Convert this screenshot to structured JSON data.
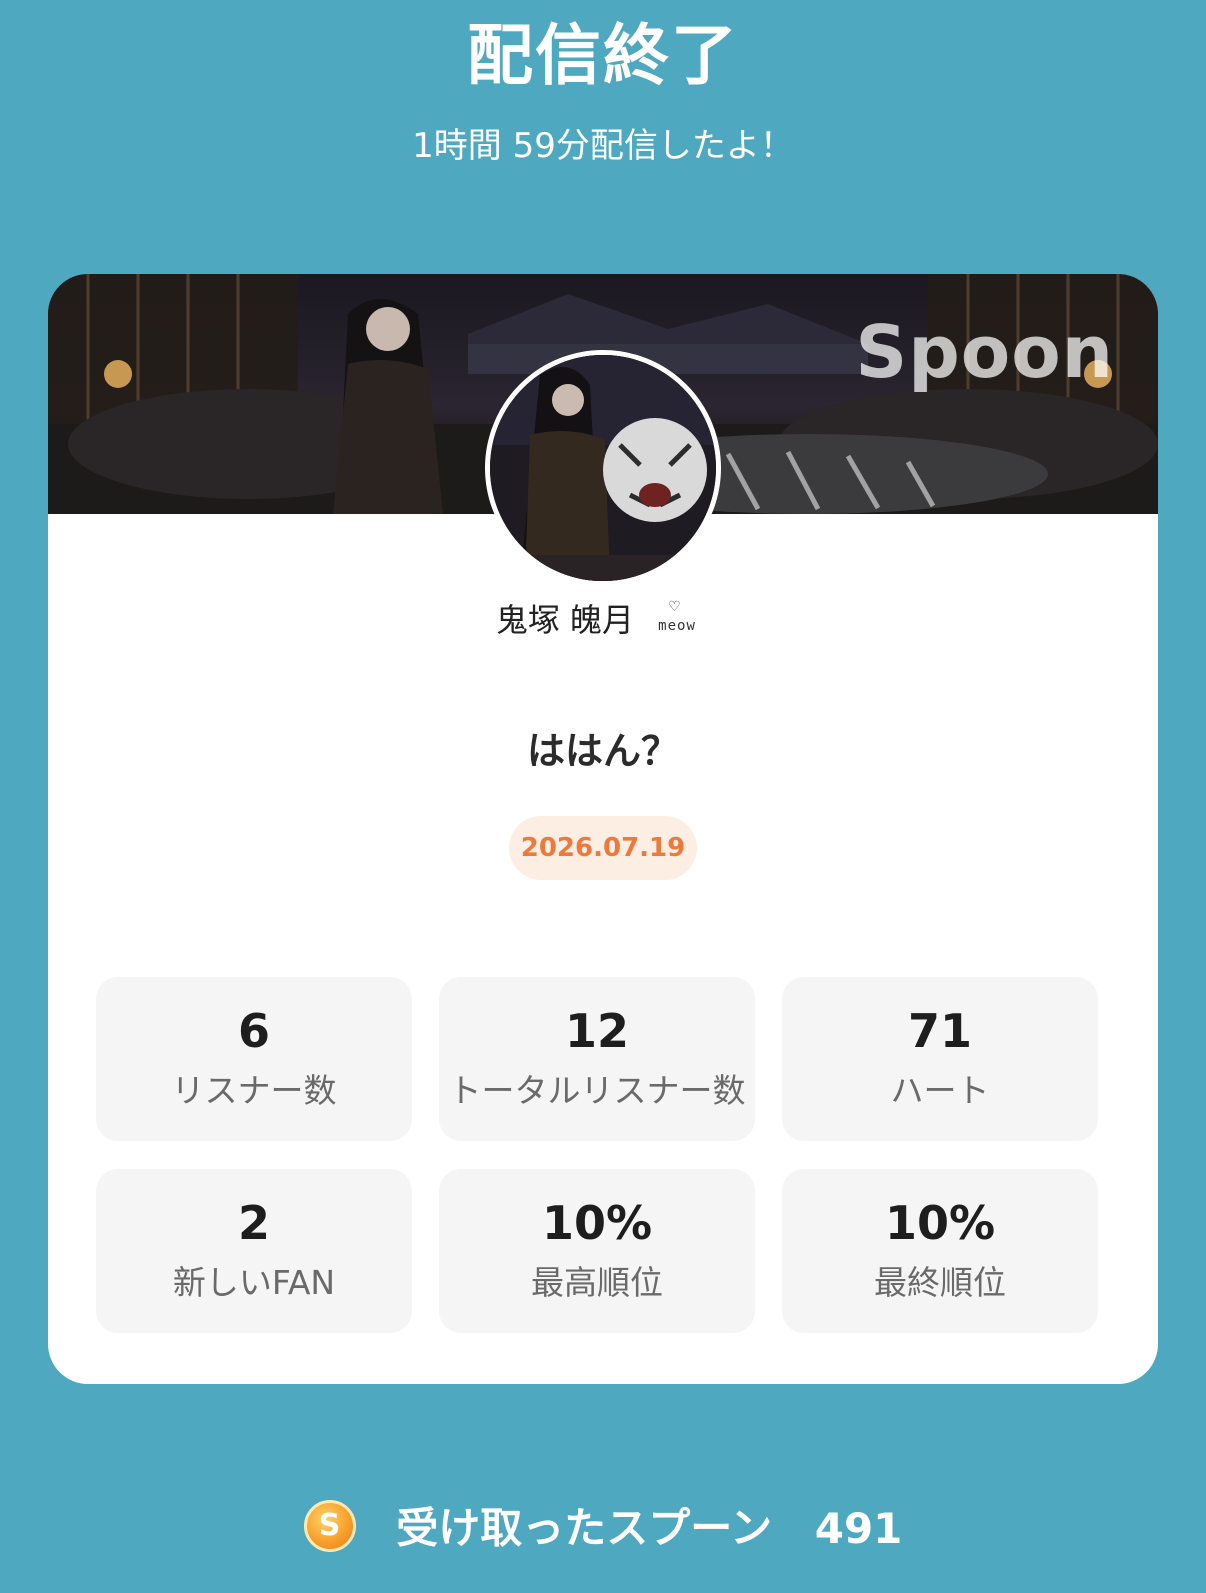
{
  "header": {
    "title": "配信終了",
    "subtitle": "1時間 59分配信したよ！"
  },
  "card": {
    "banner_logo": "Spoon",
    "user_name": "鬼塚 魄月",
    "name_badge": "meow",
    "name_badge_heart": "♡",
    "stream_title": "ははん？",
    "date": "2026.07.19",
    "stats": [
      {
        "value": "6",
        "label": "リスナー数"
      },
      {
        "value": "12",
        "label": "トータルリスナー数"
      },
      {
        "value": "71",
        "label": "ハート"
      },
      {
        "value": "2",
        "label": "新しいFAN"
      },
      {
        "value": "10%",
        "label": "最高順位"
      },
      {
        "value": "10%",
        "label": "最終順位"
      }
    ]
  },
  "footer": {
    "spoon_icon_letter": "S",
    "spoon_label": "受け取ったスプーン",
    "spoon_count": "491"
  },
  "colors": {
    "background": "#4ea8bf",
    "card": "#ffffff",
    "stat_tile": "#f5f5f5",
    "date_text": "#ec7a3c",
    "date_pill": "#fdeee3",
    "spoon_icon": "#f7a12c"
  }
}
